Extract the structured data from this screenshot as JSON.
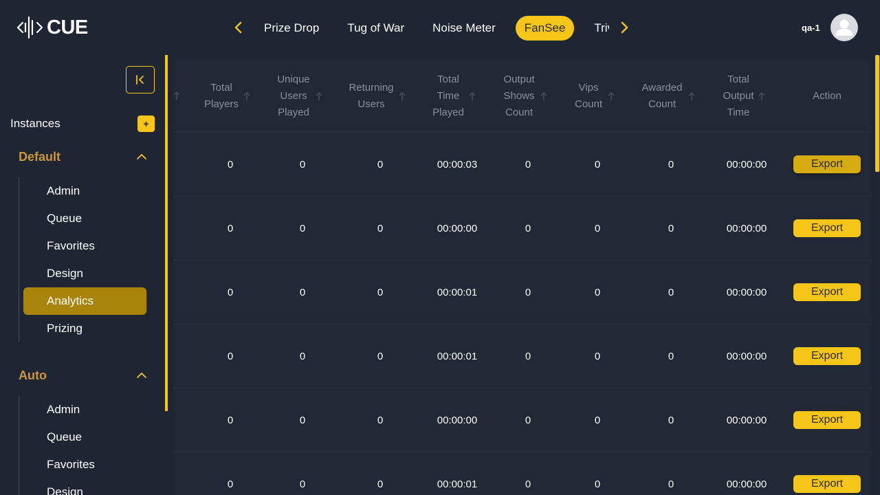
{
  "app": {
    "logo_text": "CUE",
    "user_name": "qa-1"
  },
  "tabs": [
    {
      "label": "Prize Drop"
    },
    {
      "label": "Tug of War"
    },
    {
      "label": "Noise Meter"
    },
    {
      "label": "FanSee",
      "active": true
    },
    {
      "label": "Trivia"
    }
  ],
  "sidebar": {
    "instances_label": "Instances",
    "add_label": "+",
    "groups": [
      {
        "name": "Default",
        "items": [
          "Admin",
          "Queue",
          "Favorites",
          "Design",
          "Analytics",
          "Prizing"
        ],
        "active_item": "Analytics"
      },
      {
        "name": "Auto",
        "items": [
          "Admin",
          "Queue",
          "Favorites",
          "Design"
        ]
      }
    ]
  },
  "table": {
    "columns": [
      "Total Players",
      "Unique Users Played",
      "Returning Users",
      "Total Time Played",
      "Output Shows Count",
      "Vips Count",
      "Awarded Count",
      "Total Output Time",
      "Action"
    ],
    "export_label": "Export",
    "rows": [
      [
        "0",
        "0",
        "0",
        "00:00:03",
        "0",
        "0",
        "0",
        "00:00:00"
      ],
      [
        "0",
        "0",
        "0",
        "00:00:00",
        "0",
        "0",
        "0",
        "00:00:00"
      ],
      [
        "0",
        "0",
        "0",
        "00:00:01",
        "0",
        "0",
        "0",
        "00:00:00"
      ],
      [
        "0",
        "0",
        "0",
        "00:00:01",
        "0",
        "0",
        "0",
        "00:00:00"
      ],
      [
        "0",
        "0",
        "0",
        "00:00:00",
        "0",
        "0",
        "0",
        "00:00:00"
      ],
      [
        "0",
        "0",
        "0",
        "00:00:01",
        "0",
        "0",
        "0",
        "00:00:00"
      ]
    ]
  },
  "colors": {
    "accent": "#f5c518",
    "background": "#1f2532",
    "active_menu": "#a8850a",
    "group_header": "#c9973a"
  }
}
